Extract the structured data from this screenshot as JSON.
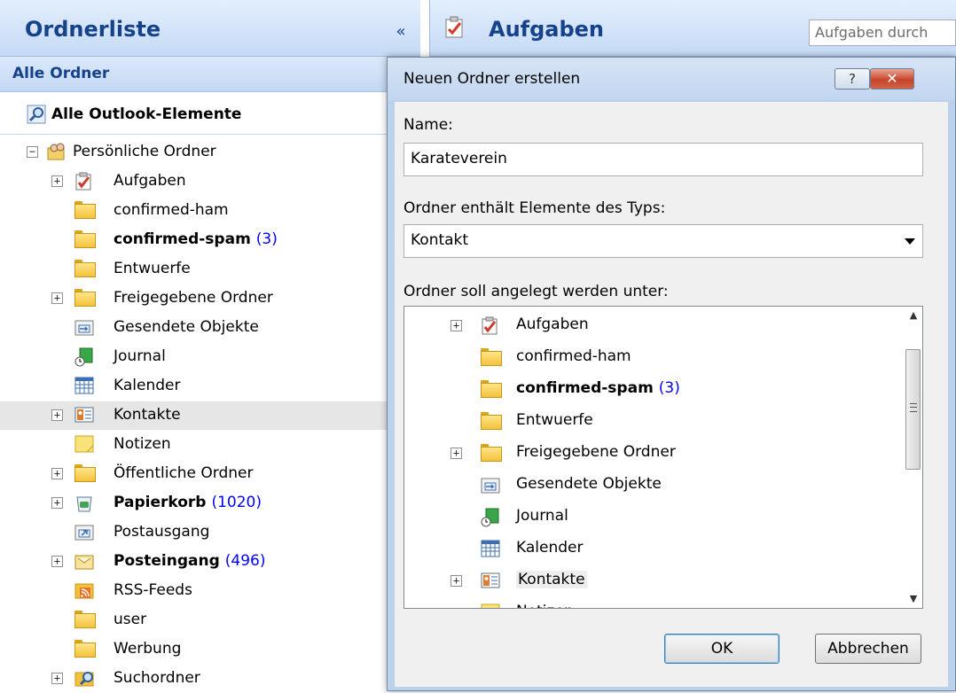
{
  "left": {
    "title": "Ordnerliste",
    "collapse": "«",
    "all_folders": "Alle Ordner",
    "all_items": "Alle Outlook-Elemente",
    "root": "Persönliche Ordner",
    "items": [
      {
        "label": "Aufgaben",
        "count": "",
        "bold": false,
        "icon": "tasks-icon",
        "expand": "+"
      },
      {
        "label": "confirmed-ham",
        "count": "",
        "bold": false,
        "icon": "folder-icon",
        "expand": ""
      },
      {
        "label": "confirmed-spam",
        "count": "(3)",
        "bold": true,
        "icon": "folder-icon",
        "expand": ""
      },
      {
        "label": "Entwuerfe",
        "count": "",
        "bold": false,
        "icon": "folder-icon",
        "expand": ""
      },
      {
        "label": "Freigegebene Ordner",
        "count": "",
        "bold": false,
        "icon": "folder-icon",
        "expand": "+"
      },
      {
        "label": "Gesendete Objekte",
        "count": "",
        "bold": false,
        "icon": "sent-items-icon",
        "expand": ""
      },
      {
        "label": "Journal",
        "count": "",
        "bold": false,
        "icon": "journal-icon",
        "expand": ""
      },
      {
        "label": "Kalender",
        "count": "",
        "bold": false,
        "icon": "calendar-icon",
        "expand": ""
      },
      {
        "label": "Kontakte",
        "count": "",
        "bold": false,
        "icon": "contacts-icon",
        "expand": "+"
      },
      {
        "label": "Notizen",
        "count": "",
        "bold": false,
        "icon": "notes-icon",
        "expand": ""
      },
      {
        "label": "Öffentliche Ordner",
        "count": "",
        "bold": false,
        "icon": "folder-icon",
        "expand": "+"
      },
      {
        "label": "Papierkorb",
        "count": "(1020)",
        "bold": true,
        "icon": "trash-icon",
        "expand": "+"
      },
      {
        "label": "Postausgang",
        "count": "",
        "bold": false,
        "icon": "outbox-icon",
        "expand": ""
      },
      {
        "label": "Posteingang",
        "count": "(496)",
        "bold": true,
        "icon": "inbox-icon",
        "expand": "+"
      },
      {
        "label": "RSS-Feeds",
        "count": "",
        "bold": false,
        "icon": "rss-icon",
        "expand": ""
      },
      {
        "label": "user",
        "count": "",
        "bold": false,
        "icon": "folder-icon",
        "expand": ""
      },
      {
        "label": "Werbung",
        "count": "",
        "bold": false,
        "icon": "folder-icon",
        "expand": ""
      },
      {
        "label": "Suchordner",
        "count": "",
        "bold": false,
        "icon": "search-folder-icon",
        "expand": "+"
      }
    ]
  },
  "right": {
    "title": "Aufgaben",
    "search_placeholder": "Aufgaben durch"
  },
  "dialog": {
    "title": "Neuen Ordner erstellen",
    "help": "?",
    "close": "✕",
    "name_label": "Name:",
    "name_value": "Karateverein",
    "type_label": "Ordner enthält Elemente des Typs:",
    "type_value": "Kontakt",
    "location_label": "Ordner soll angelegt werden unter:",
    "ok": "OK",
    "cancel": "Abbrechen",
    "tree": [
      {
        "label": "Aufgaben",
        "count": "",
        "bold": false,
        "icon": "tasks-icon",
        "expand": "+"
      },
      {
        "label": "confirmed-ham",
        "count": "",
        "bold": false,
        "icon": "folder-icon",
        "expand": ""
      },
      {
        "label": "confirmed-spam",
        "count": "(3)",
        "bold": true,
        "icon": "folder-icon",
        "expand": ""
      },
      {
        "label": "Entwuerfe",
        "count": "",
        "bold": false,
        "icon": "folder-icon",
        "expand": ""
      },
      {
        "label": "Freigegebene Ordner",
        "count": "",
        "bold": false,
        "icon": "folder-icon",
        "expand": "+"
      },
      {
        "label": "Gesendete Objekte",
        "count": "",
        "bold": false,
        "icon": "sent-items-icon",
        "expand": ""
      },
      {
        "label": "Journal",
        "count": "",
        "bold": false,
        "icon": "journal-icon",
        "expand": ""
      },
      {
        "label": "Kalender",
        "count": "",
        "bold": false,
        "icon": "calendar-icon",
        "expand": ""
      },
      {
        "label": "Kontakte",
        "count": "",
        "bold": false,
        "icon": "contacts-icon",
        "expand": "+"
      },
      {
        "label": "Notizen",
        "count": "",
        "bold": false,
        "icon": "notes-icon",
        "expand": ""
      }
    ]
  }
}
